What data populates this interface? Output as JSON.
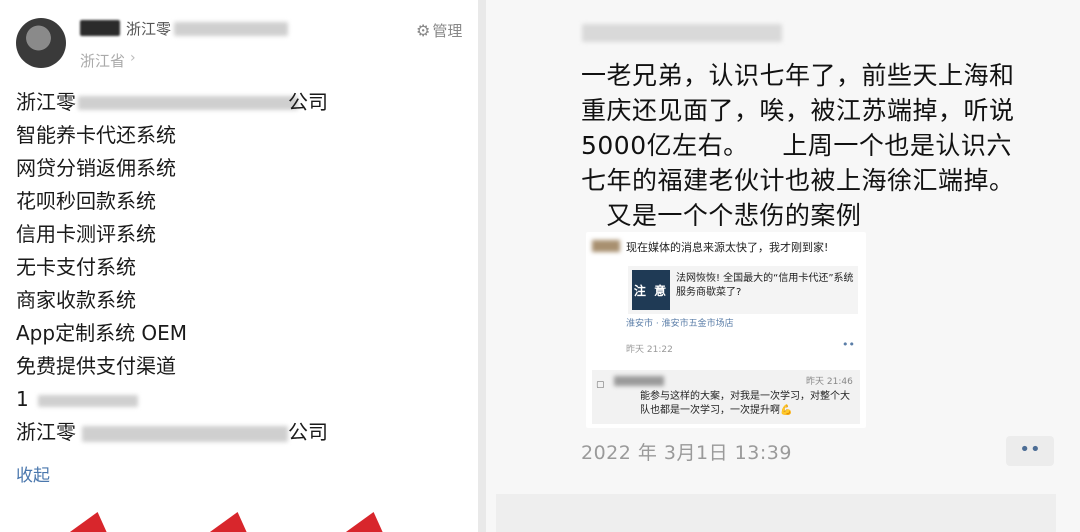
{
  "left": {
    "user_name_partial": "浙江零",
    "location": "浙江省",
    "location_chevron": "›",
    "manage_icon": "⚙",
    "manage_label": "管理",
    "lines": [
      "浙江零",
      "智能养卡代还系统",
      "网贷分销返佣系统",
      "花呗秒回款系统",
      "信用卡测评系统",
      "无卡支付系统",
      "商家收款系统",
      "App定制系统 OEM",
      "免费提供支付渠道",
      "1",
      "浙江零"
    ],
    "line1_suffix": "公司",
    "line11_suffix": "公司",
    "collapse_label": "收起"
  },
  "right": {
    "post_lines": [
      "一老兄弟，认识七年了，前些天上海和",
      "重庆还见面了，唉，被江苏端掉，听说",
      "5000亿左右。    上周一个也是认识六",
      "七年的福建老伙计也被上海徐汇端掉。",
      "   又是一个个悲伤的案例"
    ],
    "shot": {
      "message": "现在媒体的消息来源太快了，我才刚到家!",
      "badge": "注 意",
      "card_title": "法网恢恢! 全国最大的“信用卡代还”系统服务商歇菜了?",
      "place": "淮安市 · 淮安市五金市场店",
      "time": "昨天 21:22",
      "dots": "••",
      "comment_icon": "▢",
      "comment_time": "昨天 21:46",
      "comment_text": "能参与这样的大案，对我是一次学习，对整个大队也都是一次学习，一次提升啊💪"
    },
    "date": "2022 年 3月1日 13:39",
    "more_label": "••"
  }
}
